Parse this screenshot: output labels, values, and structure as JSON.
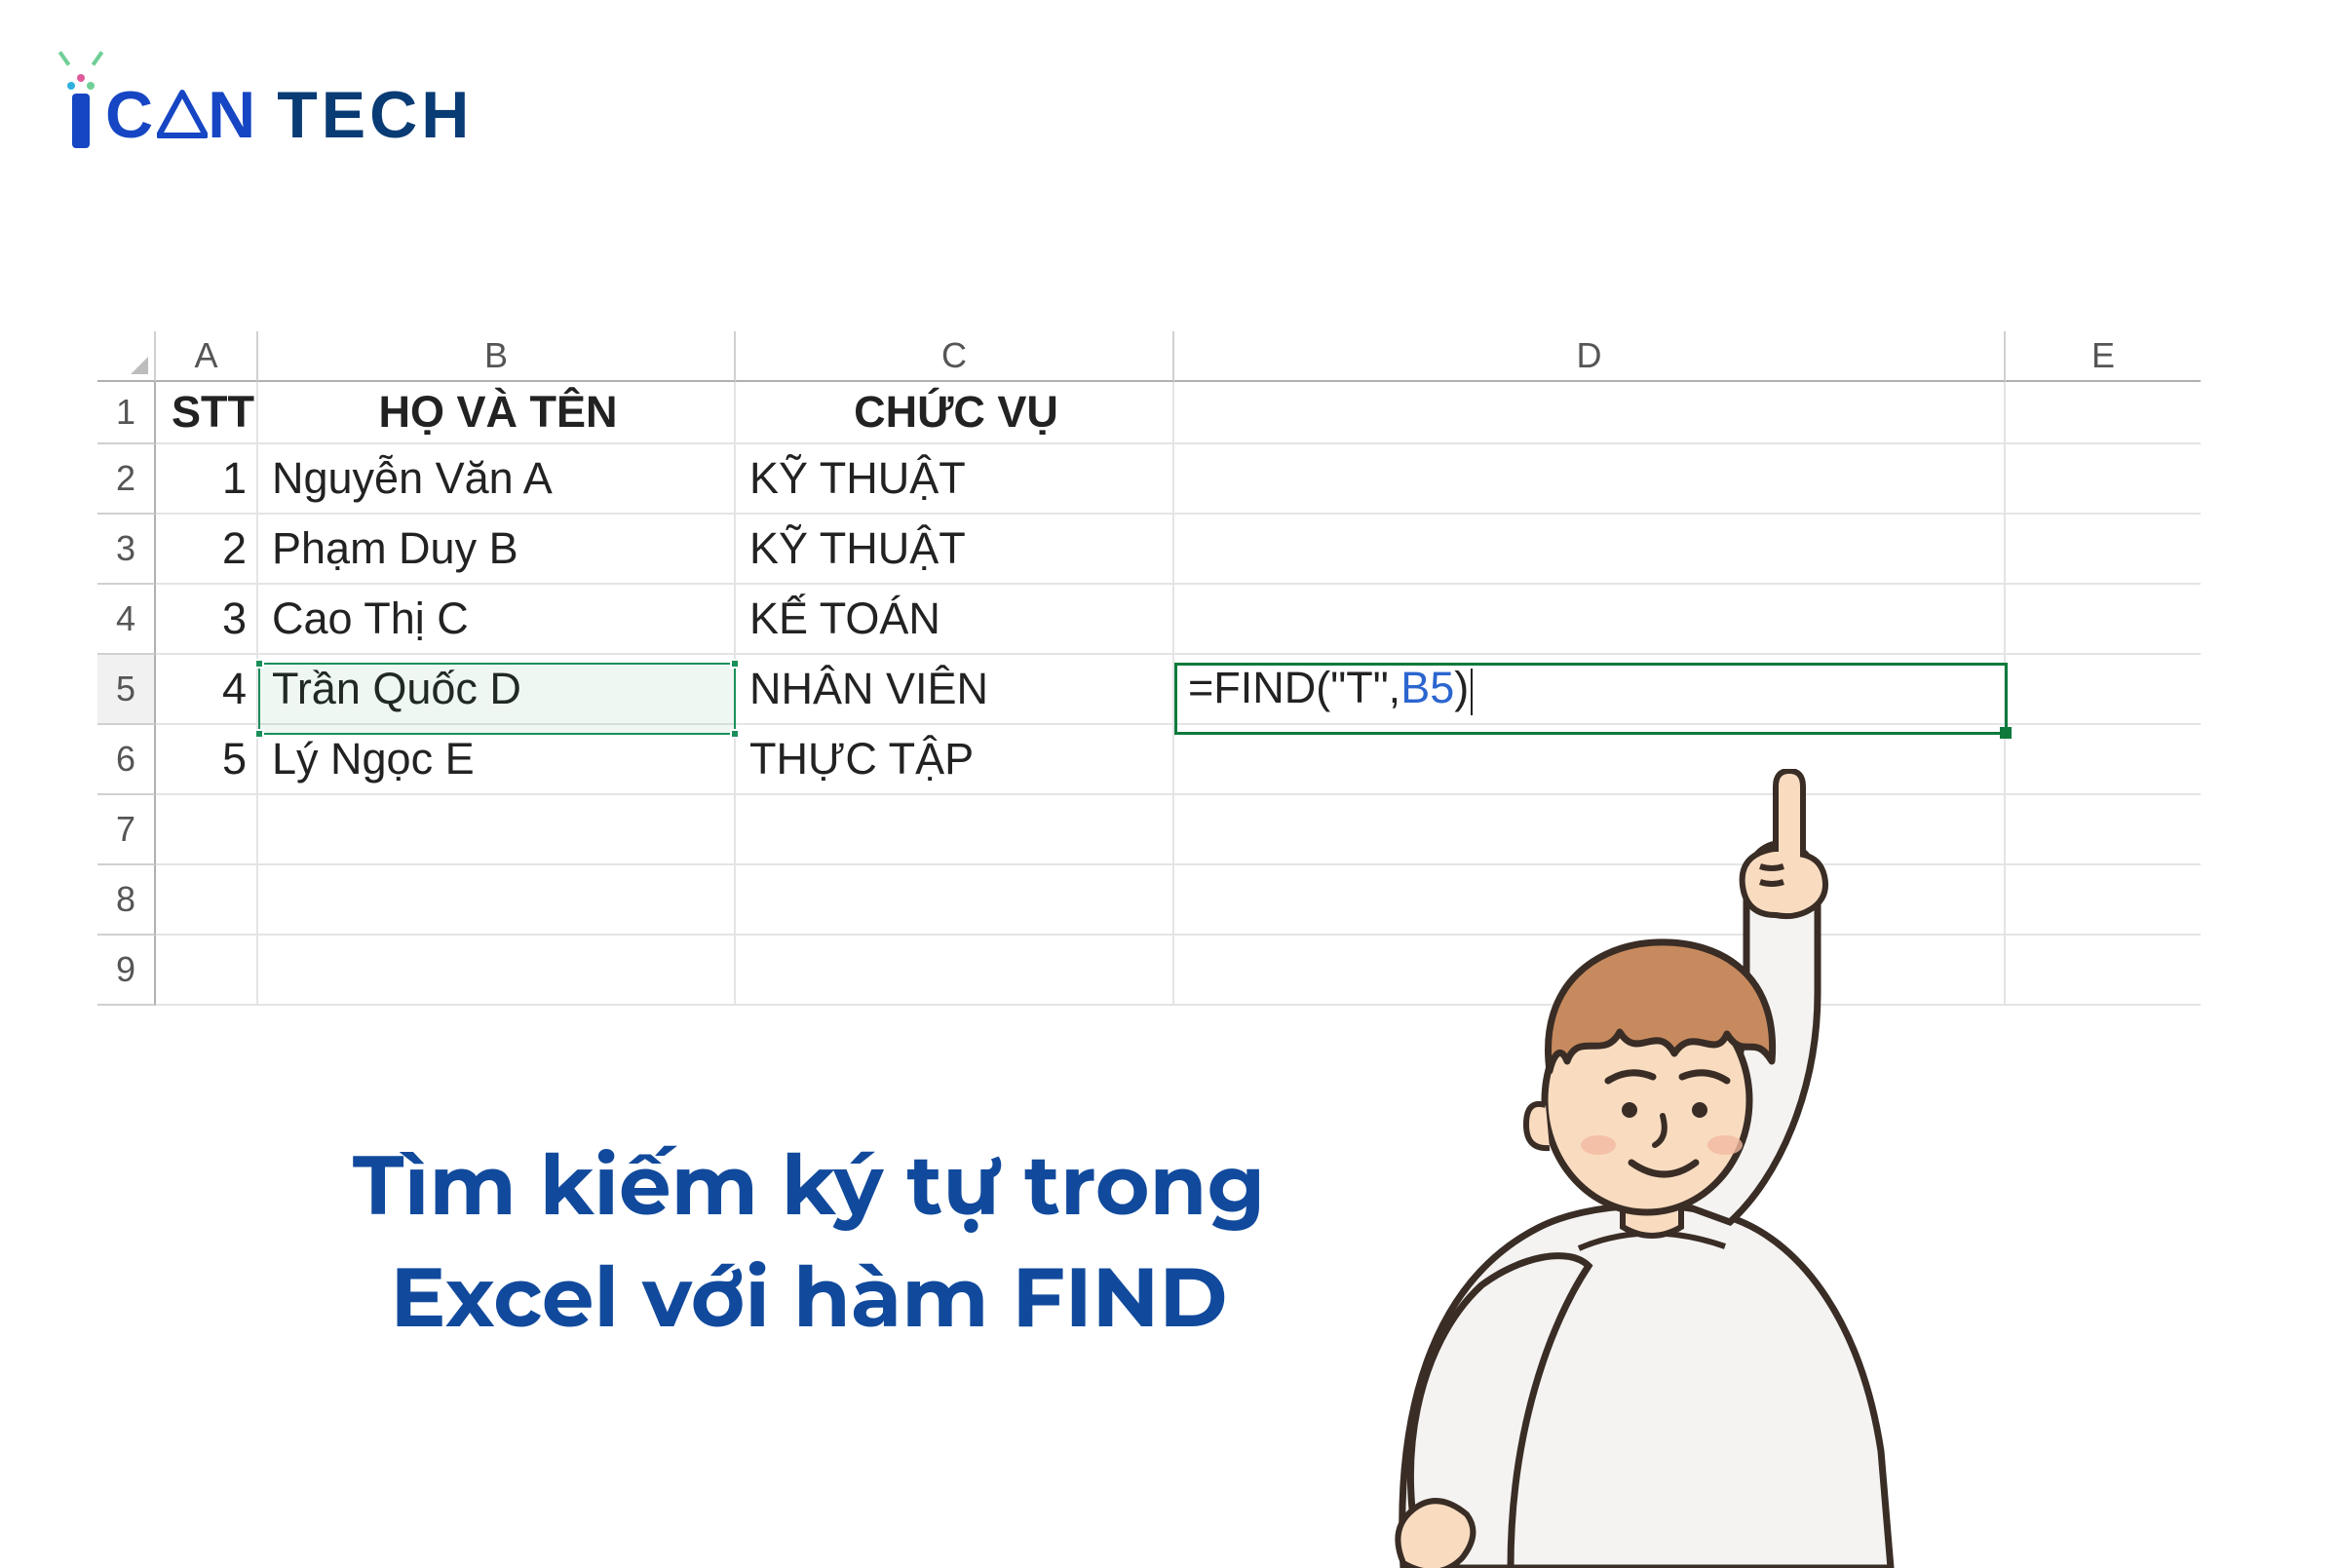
{
  "logo": {
    "can": "CΔN",
    "tech": "TECH"
  },
  "sheet": {
    "columns": [
      "A",
      "B",
      "C",
      "D",
      "E"
    ],
    "rows": [
      "1",
      "2",
      "3",
      "4",
      "5",
      "6",
      "7",
      "8",
      "9"
    ],
    "header": {
      "a": "STT",
      "b": "HỌ VÀ TÊN",
      "c": "CHỨC VỤ"
    },
    "data": [
      {
        "a": "1",
        "b": "Nguyễn Văn A",
        "c": "KỸ THUẬT"
      },
      {
        "a": "2",
        "b": "Phạm Duy B",
        "c": "KỸ THUẬT"
      },
      {
        "a": "3",
        "b": "Cao Thị C",
        "c": "KẾ TOÁN"
      },
      {
        "a": "4",
        "b": "Trần Quốc D",
        "c": "NHÂN VIÊN"
      },
      {
        "a": "5",
        "b": "Lý Ngọc E",
        "c": "THỰC TẬP"
      }
    ],
    "active_cell": "D5",
    "selected_ref_cell": "B5",
    "formula": {
      "prefix": "=FIND(\"T\",",
      "ref": "B5",
      "suffix": ")"
    }
  },
  "caption": {
    "line1": "Tìm kiếm ký tự trong",
    "line2": "Excel với hàm FIND"
  }
}
